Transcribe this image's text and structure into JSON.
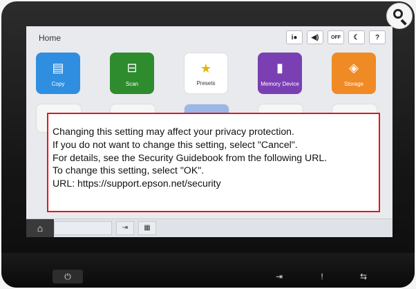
{
  "screen": {
    "home_label": "Home",
    "status_icons": [
      {
        "name": "network-status-icon",
        "glyph": "i●"
      },
      {
        "name": "volume-icon",
        "glyph": "◀)"
      },
      {
        "name": "wifi-off-icon",
        "glyph": "OFF"
      },
      {
        "name": "sleep-moon-icon",
        "glyph": "☾"
      },
      {
        "name": "help-icon",
        "glyph": "?"
      }
    ],
    "tiles": [
      {
        "label": "Copy",
        "color": "#2f8ee0",
        "icon": "copy-icon"
      },
      {
        "label": "Scan",
        "color": "#2e8b2e",
        "icon": "scan-icon"
      },
      {
        "label": "Presets",
        "color": "#ffffff",
        "icon": "presets-star-icon"
      },
      {
        "label": "Memory Device",
        "color": "#7b3fb4",
        "icon": "memory-device-icon"
      },
      {
        "label": "Storage",
        "color": "#f08a24",
        "icon": "storage-box-icon"
      }
    ]
  },
  "dialog": {
    "line1": "Changing this setting may affect your privacy protection.",
    "line2": "If you do not want to change this setting, select \"Cancel\".",
    "line3": "For details, see the Security Guidebook from the following URL.",
    "line4": "To change this setting, select \"OK\".",
    "line5": "URL: https://support.epson.net/security"
  },
  "colors": {
    "dialog_border": "#e0161d"
  }
}
